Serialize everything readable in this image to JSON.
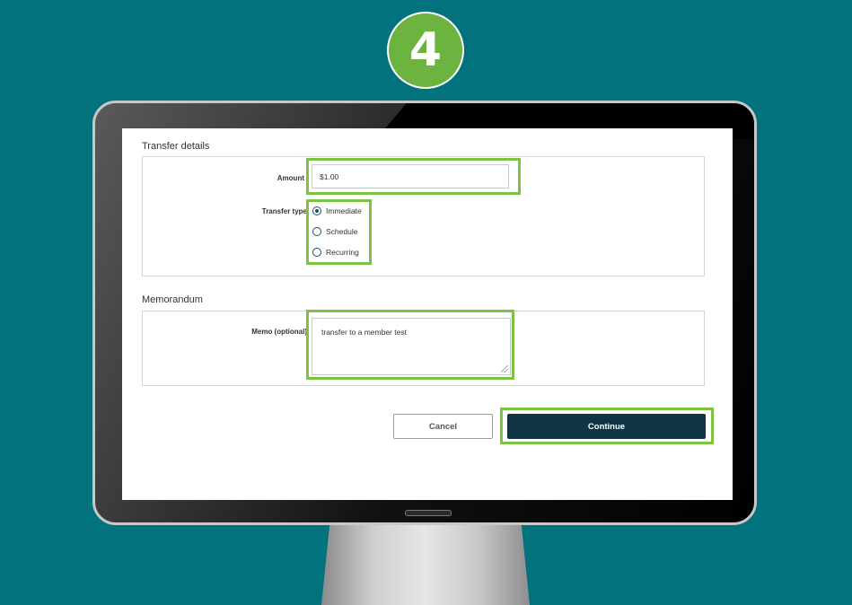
{
  "step": {
    "number": "4"
  },
  "transfer_details": {
    "heading": "Transfer details",
    "amount_label": "Amount",
    "amount_value": "$1.00",
    "transfer_type_label": "Transfer type",
    "options": [
      {
        "label": "Immediate",
        "selected": true
      },
      {
        "label": "Schedule",
        "selected": false
      },
      {
        "label": "Recurring",
        "selected": false
      }
    ]
  },
  "memorandum": {
    "heading": "Memorandum",
    "memo_label": "Memo (optional)",
    "memo_value": "transfer to a member test"
  },
  "actions": {
    "cancel_label": "Cancel",
    "continue_label": "Continue"
  },
  "colors": {
    "background": "#02737c",
    "highlight": "#7dc242",
    "badge": "#6cb33f",
    "primary_button": "#0f3443"
  }
}
